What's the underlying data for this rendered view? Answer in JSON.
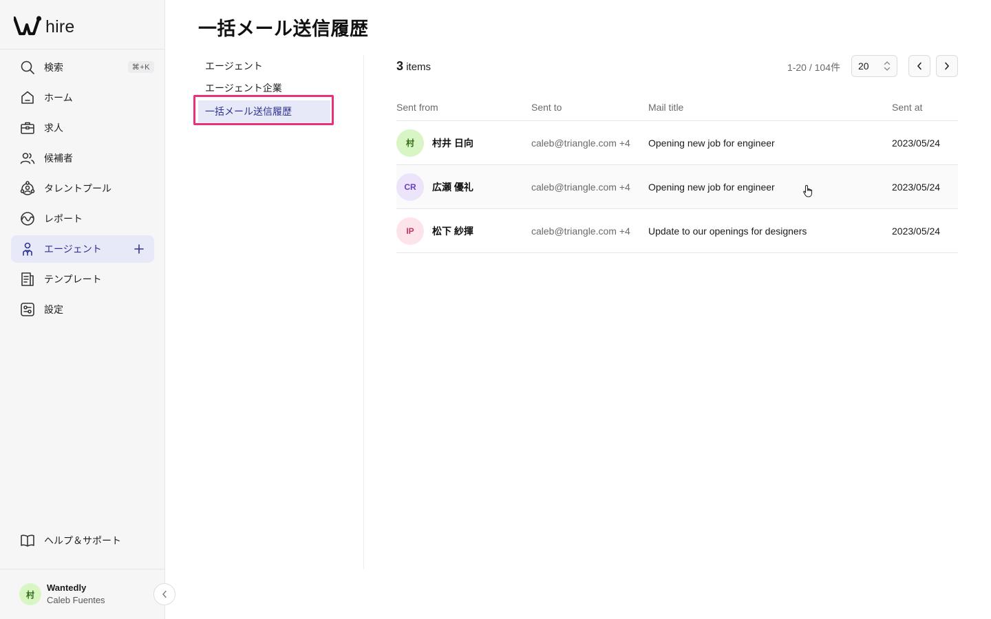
{
  "brand": {
    "name": "hire"
  },
  "sidebar": {
    "search": {
      "label": "検索",
      "shortcut": "⌘+K"
    },
    "items": [
      {
        "label": "ホーム",
        "icon": "home-icon"
      },
      {
        "label": "求人",
        "icon": "briefcase-icon"
      },
      {
        "label": "候補者",
        "icon": "people-icon"
      },
      {
        "label": "タレントプール",
        "icon": "talent-pool-icon"
      },
      {
        "label": "レポート",
        "icon": "report-icon"
      },
      {
        "label": "エージェント",
        "icon": "agent-icon",
        "active": true
      },
      {
        "label": "テンプレート",
        "icon": "template-icon"
      },
      {
        "label": "設定",
        "icon": "settings-icon"
      }
    ],
    "help": {
      "label": "ヘルプ＆サポート"
    },
    "account": {
      "initial": "村",
      "org": "Wantedly",
      "user": "Caleb Fuentes"
    }
  },
  "page": {
    "title": "一括メール送信履歴"
  },
  "subnav": {
    "items": [
      {
        "label": "エージェント"
      },
      {
        "label": "エージェント企業"
      },
      {
        "label": "一括メール送信履歴",
        "active": true
      }
    ]
  },
  "list": {
    "count": "3",
    "count_suffix": "items",
    "range": "1-20 / 104件",
    "per_page": "20",
    "columns": [
      "Sent from",
      "Sent to",
      "Mail title",
      "Sent at"
    ],
    "rows": [
      {
        "initials": "村",
        "avatar_bg": "#d8f5c4",
        "avatar_fg": "#2f6b14",
        "name": "村井 日向",
        "to": "caleb@triangle.com +4",
        "title": "Opening new job for engineer",
        "sent_at": "2023/05/24"
      },
      {
        "initials": "CR",
        "avatar_bg": "#ece4fb",
        "avatar_fg": "#6a3fc0",
        "name": "広瀬 優礼",
        "to": "caleb@triangle.com +4",
        "title": "Opening new job for engineer",
        "sent_at": "2023/05/24"
      },
      {
        "initials": "IP",
        "avatar_bg": "#fde3ea",
        "avatar_fg": "#c2345a",
        "name": "松下 紗揮",
        "to": "caleb@triangle.com +4",
        "title": "Update to our openings for designers",
        "sent_at": "2023/05/24"
      }
    ]
  },
  "colors": {
    "accent": "#2e3192",
    "active_bg": "#e8e9f8",
    "highlight": "#e8317a"
  }
}
